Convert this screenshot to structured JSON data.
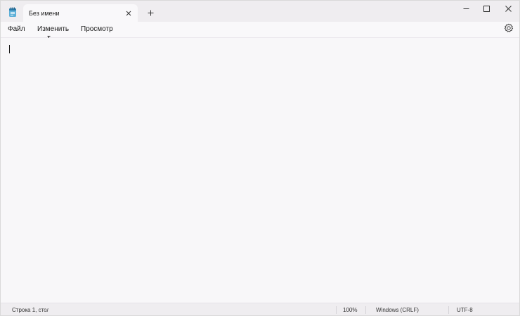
{
  "titlebar": {
    "app_icon": "notepad-icon",
    "tab_title": "Без имени",
    "close_tab_icon": "close-icon",
    "new_tab_icon": "plus-icon",
    "window_buttons": [
      "minimize-icon",
      "maximize-icon",
      "close-icon"
    ]
  },
  "menu": {
    "items": [
      "Файл",
      "Изменить",
      "Просмотр"
    ],
    "settings_icon": "gear-icon"
  },
  "editor": {
    "text": ""
  },
  "statusbar": {
    "position": "Строка 1, стол",
    "zoom": "100%",
    "line_ending": "Windows (CRLF)",
    "encoding": "UTF-8"
  },
  "colors": {
    "titlebar_bg": "#efedf0",
    "tab_bg": "#f9f8fa",
    "editor_bg": "#f8f7f9",
    "statusbar_bg": "#efedf0",
    "notepad_icon_accent": "#3d8fbf"
  }
}
